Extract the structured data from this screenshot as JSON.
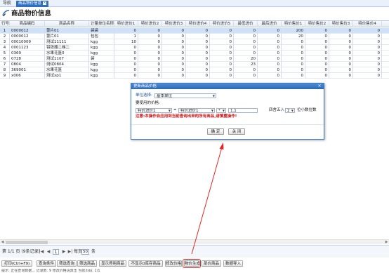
{
  "tabs": {
    "nav_label": "导航",
    "active_label": "商品物价信息"
  },
  "page": {
    "title": "商品物价信息"
  },
  "grid": {
    "columns": [
      "行号",
      "商品编码",
      "商品名称",
      "计量单位名称",
      "特价进价1",
      "特价进价2",
      "特价进价3",
      "特价进价4",
      "特价进价5",
      "最低进价",
      "最后进价",
      "特价售价1",
      "特价售价2",
      "特价售价3",
      "特价售价4"
    ],
    "rows": [
      [
        "1",
        "0000012",
        "蓖片01",
        "袋袋",
        "0",
        "0",
        "0",
        "0",
        "0",
        "0",
        "0",
        "200",
        "0",
        "0",
        "0"
      ],
      [
        "2",
        "0000012",
        "蓖片01",
        "包包",
        "1",
        "0",
        "0",
        "0",
        "0",
        "0",
        "0",
        "20",
        "0",
        "0",
        "0"
      ],
      [
        "3",
        "00010009",
        "测试11111",
        "kgg",
        "10",
        "0",
        "0",
        "0",
        "0",
        "0",
        "0",
        "0",
        "0",
        "0",
        "0"
      ],
      [
        "4",
        "0001123",
        "铝铁器二梯二",
        "kgg",
        "0",
        "0",
        "0",
        "0",
        "0",
        "0",
        "0",
        "0",
        "0",
        "0",
        "0"
      ],
      [
        "5",
        "0369",
        "水果花篮0",
        "kgg",
        "0",
        "0",
        "0",
        "0",
        "0",
        "0",
        "0",
        "0",
        "0",
        "0",
        "0"
      ],
      [
        "6",
        "0728",
        "测试1107",
        "袋",
        "0",
        "0",
        "0",
        "0",
        "0",
        "20",
        "0",
        "0",
        "0",
        "0",
        "0"
      ],
      [
        "7",
        "0804",
        "测试0804",
        "kgg",
        "0",
        "0",
        "0",
        "0",
        "0",
        "23",
        "0",
        "0",
        "0",
        "0",
        "0"
      ],
      [
        "8",
        "369001",
        "水果花篮",
        "kgg",
        "0",
        "0",
        "0",
        "0",
        "0",
        "0",
        "0",
        "0",
        "0",
        "0",
        "0"
      ],
      [
        "9",
        "x006",
        "测试xp1",
        "kgg",
        "0",
        "0",
        "0",
        "0",
        "0",
        "0",
        "0",
        "0",
        "0",
        "0",
        "0"
      ]
    ]
  },
  "pager": {
    "summary": "第 1/1 页 (9条记录)",
    "page_input": "1",
    "page_size_prefix": "每页",
    "page_size": "50",
    "page_size_suffix": "条"
  },
  "toolbar": {
    "buttons": [
      "打印(Ctrl+F9)",
      "查询条件",
      "筛选查询",
      "筛选商品",
      "显示停用商品",
      "不显示0库存商品",
      "修改价格",
      "物价生成",
      "部价商品",
      "数据导入"
    ],
    "highlighted": "物价生成"
  },
  "status": {
    "text": "提示: 正在查询数据...   记录数: 9   修改价格请双击  当前页码: 1/1"
  },
  "dialog": {
    "title": "更新商品价格",
    "unit_label": "单位选择:",
    "unit_value": "基本单位",
    "update_label": "要使用的价格:",
    "target_value": "特价进价1",
    "source_value": "特价进价1",
    "operator_value": "*",
    "factor_value": "1.1",
    "round_label": "四舍五入",
    "decimals_value": "2",
    "decimals_suffix": "位小数位数",
    "equals_sign": "=",
    "warning": "注意:本操作会应用到当前查询出来的所有商品,请慎重操作!",
    "ok_label": "确 定",
    "close_label": "关 闭"
  },
  "colors": {
    "accent": "#2f6fc1",
    "selected_row": "#cfe1f9",
    "warning": "#d01010",
    "arrow": "#e32626"
  }
}
